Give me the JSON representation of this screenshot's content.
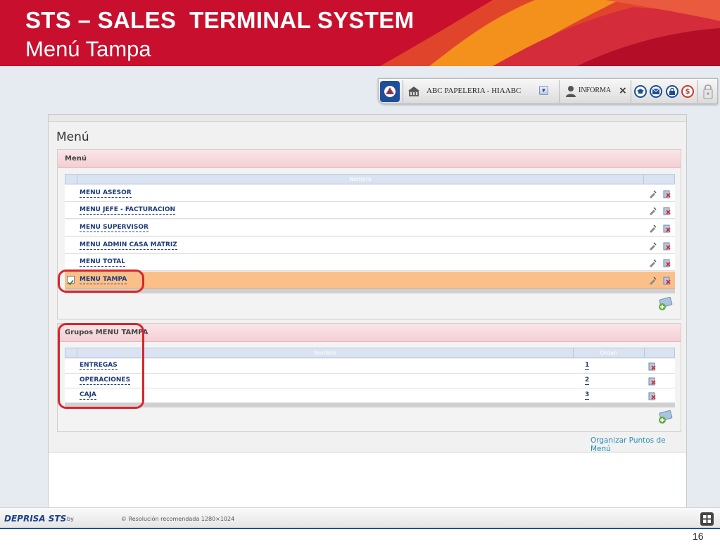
{
  "slide": {
    "title": "STS – SALES  TERMINAL SYSTEM",
    "subtitle": "Menú Tampa",
    "page_number": "16",
    "accent": "#c8102e"
  },
  "toolbar": {
    "company": "ABC PAPELERIA - HIAABC",
    "user": "INFORMA",
    "icons": [
      "sts-logo-icon",
      "building-icon",
      "dropdown-icon",
      "user-icon",
      "close-icon",
      "graduation-icon",
      "mail-icon",
      "lock-icon",
      "dollar-icon",
      "logout-icon"
    ]
  },
  "page": {
    "heading": "Menú",
    "organize_link": "Organizar Puntos de Menú"
  },
  "menu_section": {
    "title": "Menú",
    "column_nombre": "Nombre",
    "rows": [
      {
        "label": "MENU ASESOR",
        "selected": false
      },
      {
        "label": "MENU JEFE - FACTURACION",
        "selected": false
      },
      {
        "label": "MENU SUPERVISOR",
        "selected": false
      },
      {
        "label": "MENU ADMIN CASA MATRIZ",
        "selected": false
      },
      {
        "label": "MENU TOTAL",
        "selected": false
      },
      {
        "label": "MENU TAMPA",
        "selected": true
      }
    ]
  },
  "groups_section": {
    "title": "Grupos MENU TAMPA",
    "column_nombre": "Nombre",
    "column_orden": "Orden",
    "rows": [
      {
        "label": "ENTREGAS",
        "order": "1"
      },
      {
        "label": "OPERACIONES",
        "order": "2"
      },
      {
        "label": "CAJA",
        "order": "3"
      }
    ]
  },
  "footer": {
    "logo": "DEPRISA STS",
    "by": "by",
    "resolution": "© Resolución recomendada 1280×1024"
  },
  "colors": {
    "selected_row": "#fbbf8a",
    "section_header": "#f3cfd4",
    "link": "#2a8fb8",
    "callout": "#d9252a"
  }
}
